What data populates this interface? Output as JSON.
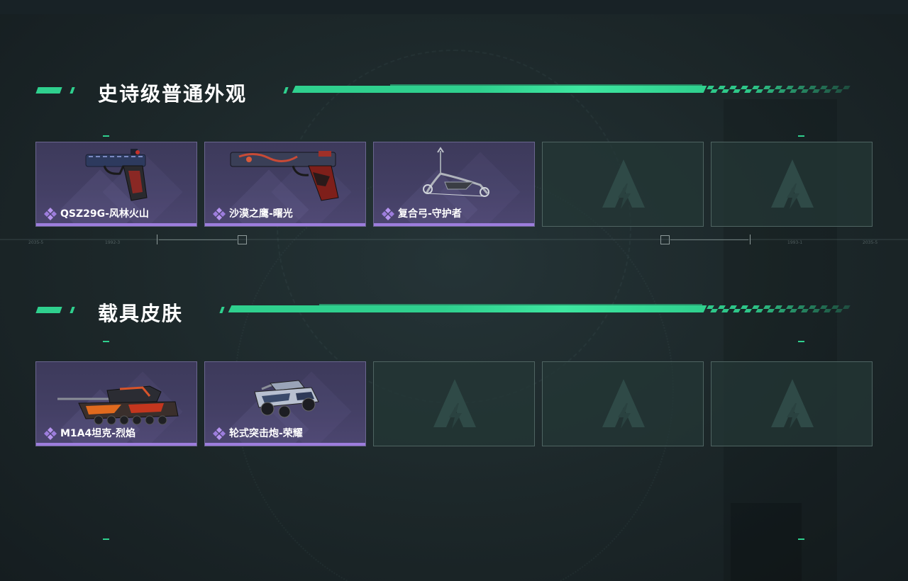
{
  "sections": [
    {
      "title": "史诗级普通外观",
      "items": [
        {
          "name": "QSZ29G-风林火山",
          "kind": "pistol"
        },
        {
          "name": "沙漠之鹰-曙光",
          "kind": "deagle"
        },
        {
          "name": "复合弓-守护者",
          "kind": "bow"
        }
      ],
      "empty_slots": 2
    },
    {
      "title": "载具皮肤",
      "items": [
        {
          "name": "M1A4坦克-烈焰",
          "kind": "tank"
        },
        {
          "name": "轮式突击炮-荣耀",
          "kind": "armored-car"
        }
      ],
      "empty_slots": 3
    }
  ],
  "ruler_labels": [
    "2035-5",
    "1992-3",
    "1993-1",
    "2035-5"
  ],
  "colors": {
    "accent_green": "#2fd08e",
    "epic_purple": "#9d7ddd",
    "card_purple": "#433f64",
    "empty_slot": "#243836"
  },
  "icons": {
    "rarity": "purple-diamond-cluster-icon",
    "empty_slot": "game-logo-icon"
  }
}
